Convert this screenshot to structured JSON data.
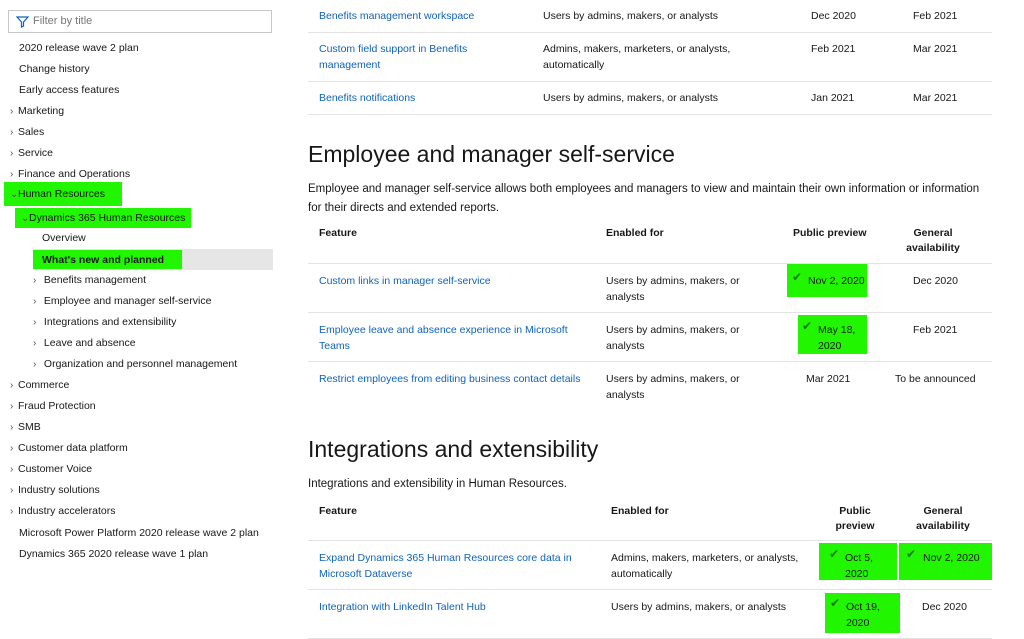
{
  "sidebar": {
    "filter_placeholder": "Filter by title",
    "items": [
      {
        "label": "2020 release wave 2 plan",
        "chevron": ""
      },
      {
        "label": "Change history",
        "chevron": ""
      },
      {
        "label": "Early access features",
        "chevron": ""
      },
      {
        "label": "Marketing",
        "chevron": "›"
      },
      {
        "label": "Sales",
        "chevron": "›"
      },
      {
        "label": "Service",
        "chevron": "›"
      },
      {
        "label": "Finance and Operations",
        "chevron": "›"
      },
      {
        "label": "Human Resources",
        "chevron": "⌄"
      },
      {
        "label": "Dynamics 365 Human Resources",
        "chevron": "⌄"
      },
      {
        "label": "Overview",
        "chevron": ""
      },
      {
        "label": "What's new and planned",
        "chevron": ""
      },
      {
        "label": "Benefits management",
        "chevron": "›"
      },
      {
        "label": "Employee and manager self-service",
        "chevron": "›"
      },
      {
        "label": "Integrations and extensibility",
        "chevron": "›"
      },
      {
        "label": "Leave and absence",
        "chevron": "›"
      },
      {
        "label": "Organization and personnel management",
        "chevron": "›"
      },
      {
        "label": "Commerce",
        "chevron": "›"
      },
      {
        "label": "Fraud Protection",
        "chevron": "›"
      },
      {
        "label": "SMB",
        "chevron": "›"
      },
      {
        "label": "Customer data platform",
        "chevron": "›"
      },
      {
        "label": "Customer Voice",
        "chevron": "›"
      },
      {
        "label": "Industry solutions",
        "chevron": "›"
      },
      {
        "label": "Industry accelerators",
        "chevron": "›"
      },
      {
        "label": "Microsoft Power Platform 2020 release wave 2 plan",
        "chevron": ""
      },
      {
        "label": "Dynamics 365 2020 release wave 1 plan",
        "chevron": ""
      }
    ]
  },
  "benefits_table": {
    "rows": [
      {
        "feature": "Benefits management workspace",
        "enabled": "Users by admins, makers, or analysts",
        "preview": "Dec 2020",
        "ga": "Feb 2021"
      },
      {
        "feature_l1": "Custom field support in Benefits",
        "feature_l2": "management",
        "enabled_l1": "Admins, makers, marketers, or analysts,",
        "enabled_l2": "automatically",
        "preview": "Feb 2021",
        "ga": "Mar 2021"
      },
      {
        "feature": "Benefits notifications",
        "enabled": "Users by admins, makers, or analysts",
        "preview": "Jan 2021",
        "ga": "Mar 2021"
      }
    ]
  },
  "self_service": {
    "heading": "Employee and manager self-service",
    "desc_l1": "Employee and manager self-service allows both employees and managers to view and maintain their own information or information",
    "desc_l2": "for their directs and extended reports.",
    "headers": {
      "feature": "Feature",
      "enabled": "Enabled for",
      "preview": "Public preview",
      "ga_l1": "General",
      "ga_l2": "availability"
    },
    "rows": [
      {
        "feature": "Custom links in manager self-service",
        "enabled_l1": "Users by admins, makers, or",
        "enabled_l2": "analysts",
        "preview": "Nov 2, 2020",
        "ga": "Dec 2020"
      },
      {
        "feature_l1": "Employee leave and absence experience in Microsoft",
        "feature_l2": "Teams",
        "enabled_l1": "Users by admins, makers, or",
        "enabled_l2": "analysts",
        "preview_l1": "May 18,",
        "preview_l2": "2020",
        "ga": "Feb 2021"
      },
      {
        "feature": "Restrict employees from editing business contact details",
        "enabled_l1": "Users by admins, makers, or",
        "enabled_l2": "analysts",
        "preview": "Mar 2021",
        "ga": "To be announced"
      }
    ]
  },
  "integrations": {
    "heading": "Integrations and extensibility",
    "desc": "Integrations and extensibility in Human Resources.",
    "headers": {
      "feature": "Feature",
      "enabled": "Enabled for",
      "preview_l1": "Public",
      "preview_l2": "preview",
      "ga_l1": "General",
      "ga_l2": "availability"
    },
    "rows": [
      {
        "feature_l1": "Expand Dynamics 365 Human Resources core data in",
        "feature_l2": "Microsoft Dataverse",
        "enabled_l1": "Admins, makers, marketers, or analysts,",
        "enabled_l2": "automatically",
        "preview_l1": "Oct 5,",
        "preview_l2": "2020",
        "ga": "Nov 2, 2020"
      },
      {
        "feature": "Integration with LinkedIn Talent Hub",
        "enabled": "Users by admins, makers, or analysts",
        "preview_l1": "Oct 19,",
        "preview_l2": "2020",
        "ga": "Dec 2020"
      }
    ]
  },
  "icons": {
    "check": "✔",
    "filter": "filter-icon"
  },
  "colors": {
    "highlight": "#22f500",
    "link": "#0f63b8",
    "check": "#117a11"
  }
}
